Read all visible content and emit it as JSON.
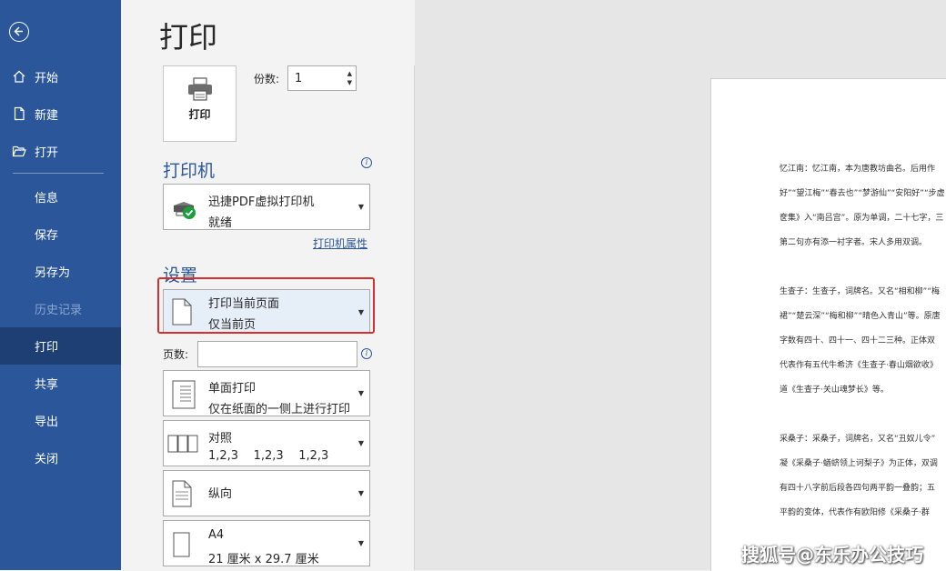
{
  "sidebar": {
    "back_icon": "back-arrow-icon",
    "top_items": [
      {
        "label": "开始",
        "icon": "home-icon"
      },
      {
        "label": "新建",
        "icon": "new-doc-icon"
      },
      {
        "label": "打开",
        "icon": "folder-open-icon"
      }
    ],
    "bottom_items": [
      {
        "label": "信息"
      },
      {
        "label": "保存"
      },
      {
        "label": "另存为"
      },
      {
        "label": "历史记录",
        "disabled": true
      },
      {
        "label": "打印",
        "active": true
      },
      {
        "label": "共享"
      },
      {
        "label": "导出"
      },
      {
        "label": "关闭"
      }
    ],
    "color": "#2b579a"
  },
  "main": {
    "title": "打印",
    "print_button_label": "打印",
    "copies_label": "份数:",
    "copies_value": "1"
  },
  "printer": {
    "section_title": "打印机",
    "name": "迅捷PDF虚拟打印机",
    "status": "就绪",
    "properties_link": "打印机属性"
  },
  "settings": {
    "section_title": "设置",
    "print_range": {
      "title": "打印当前页面",
      "subtitle": "仅当前页"
    },
    "pages_label": "页数:",
    "pages_value": "",
    "sides": {
      "title": "单面打印",
      "subtitle": "仅在纸面的一侧上进行打印"
    },
    "collation": {
      "title": "对照",
      "subtitle": "1,2,3    1,2,3    1,2,3"
    },
    "orientation": {
      "title": "纵向"
    },
    "paper": {
      "title": "A4",
      "subtitle": "21 厘米 x 29.7 厘米"
    }
  },
  "preview": {
    "lines": [
      "忆江南：忆江南，本为唐教坊曲名。后用作",
      "好”“望江梅”“春去也”“梦游仙”“安阳好”“步虚",
      "奁集》入“南吕宫”。原为单调，二十七字，三",
      "第二句亦有添一衬字者。宋人多用双调。",
      "",
      "生查子：生查子，词牌名。又名“相和柳”“梅",
      "裙”“楚云深”“梅和柳”“晴色入青山”等。原唐",
      "字数有四十、四十一、四十二三种。正体双",
      "代表作有五代牛希济《生查子·春山烟欲收》",
      "道《生查子·关山魂梦长》等。",
      "",
      "采桑子：采桑子，词牌名，又名“丑奴儿令”",
      "凝《采桑子·蝤蛴领上诃梨子》为正体，双调",
      "有四十八字前后段各四句两平韵一叠韵；五",
      "平韵的变体，代表作有欧阳修《采桑子·群"
    ]
  },
  "watermark": "搜狐号@东乐办公技巧"
}
